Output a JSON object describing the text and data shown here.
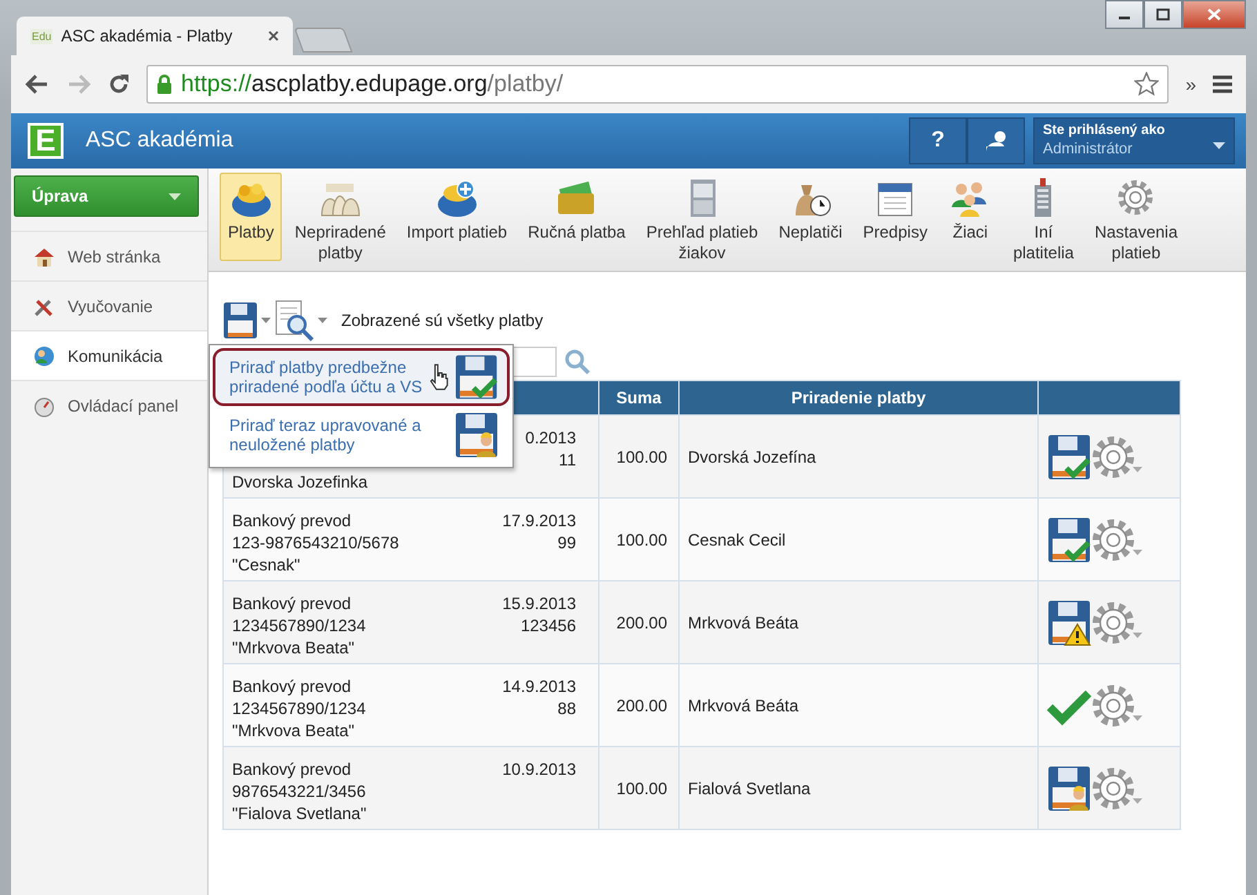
{
  "browser": {
    "tab": {
      "favicon": "Edu",
      "title": "ASC akadémia - Platby"
    },
    "url": {
      "scheme": "https://",
      "host": "ascplatby.edupage.org",
      "path": "/platby/"
    },
    "overflow": "»"
  },
  "app": {
    "logo": "E",
    "title": "ASC akadémia",
    "help": "?",
    "user": {
      "label": "Ste prihlásený ako",
      "name": "Administrátor"
    }
  },
  "sidebar": {
    "button": "Úprava",
    "items": [
      {
        "label": "Web stránka",
        "kind": "house",
        "selected": false
      },
      {
        "label": "Vyučovanie",
        "kind": "tools",
        "selected": false
      },
      {
        "label": "Komunikácia",
        "kind": "people",
        "selected": true
      },
      {
        "label": "Ovládací panel",
        "kind": "dashboard",
        "selected": false
      }
    ]
  },
  "toolbar": [
    {
      "lines": [
        "Platby"
      ],
      "kind": "coins",
      "selected": true
    },
    {
      "lines": [
        "Nepriradené",
        "platby"
      ],
      "kind": "bags",
      "selected": false
    },
    {
      "lines": [
        "Import platieb"
      ],
      "kind": "import",
      "selected": false
    },
    {
      "lines": [
        "Ručná platba"
      ],
      "kind": "wallet",
      "selected": false
    },
    {
      "lines": [
        "Prehľad platieb",
        "žiakov"
      ],
      "kind": "cabinet",
      "selected": false
    },
    {
      "lines": [
        "Neplatiči"
      ],
      "kind": "moneybag",
      "selected": false
    },
    {
      "lines": [
        "Predpisy"
      ],
      "kind": "calendar",
      "selected": false
    },
    {
      "lines": [
        "Žiaci"
      ],
      "kind": "people",
      "selected": false
    },
    {
      "lines": [
        "Iní",
        "platitelia"
      ],
      "kind": "building",
      "selected": false
    },
    {
      "lines": [
        "Nastavenia",
        "platieb"
      ],
      "kind": "gear",
      "selected": false
    }
  ],
  "content": {
    "caption": "Zobrazené sú všetky platby",
    "menu": [
      {
        "lines": [
          "Priraď platby predbežne",
          "priradené podľa účtu a VS"
        ],
        "kind": "save-check",
        "selected": true
      },
      {
        "lines": [
          "Priraď teraz upravované a",
          "neuložené platby"
        ],
        "kind": "save-person",
        "selected": false
      }
    ]
  },
  "table": {
    "columns": [
      "Suma",
      "Priradenie platby"
    ],
    "rows": [
      {
        "payer": "Dvorska Jozefinka",
        "date": "0.2013",
        "ref": "11",
        "sum": "100.00",
        "assigned": "Dvorská Jozefína",
        "kind": "save-check"
      },
      {
        "transfer": "Bankový prevod",
        "account": "123-9876543210/5678",
        "payer": "\"Cesnak\"",
        "date": "17.9.2013",
        "ref": "99",
        "sum": "100.00",
        "assigned": "Cesnak Cecil",
        "kind": "save-check"
      },
      {
        "transfer": "Bankový prevod",
        "account": "1234567890/1234",
        "payer": "\"Mrkvova Beata\"",
        "date": "15.9.2013",
        "ref": "123456",
        "sum": "200.00",
        "assigned": "Mrkvová Beáta",
        "kind": "save-warning"
      },
      {
        "transfer": "Bankový prevod",
        "account": "1234567890/1234",
        "payer": "\"Mrkvova Beata\"",
        "date": "14.9.2013",
        "ref": "88",
        "sum": "200.00",
        "assigned": "Mrkvová Beáta",
        "kind": "check"
      },
      {
        "transfer": "Bankový prevod",
        "account": "9876543221/3456",
        "payer": "\"Fialova Svetlana\"",
        "date": "10.9.2013",
        "sum": "100.00",
        "assigned": "Fialová Svetlana",
        "kind": "save-person"
      }
    ]
  }
}
